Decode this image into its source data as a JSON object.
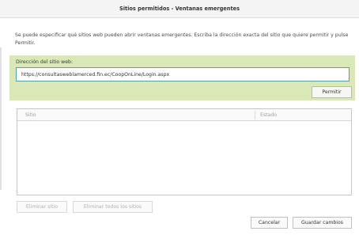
{
  "dialog": {
    "title": "Sitios permitidos - Ventanas emergentes",
    "description": "Se puede especificar qué sitios web pueden abrir ventanas emergentes. Escriba la dirección exacta del sitio que quiere permitir y pulse Permitir."
  },
  "address": {
    "label": "Dirección del sitio web:",
    "value": "https://consultasweblamerced.fin.ec/CoopOnLine/Login.aspx",
    "allow_label": "Permitir"
  },
  "table": {
    "columns": [
      "Sitio",
      "Estado"
    ],
    "rows": []
  },
  "buttons": {
    "remove_site": "Eliminar sitio",
    "remove_all": "Eliminar todos los sitios",
    "cancel": "Cancelar",
    "save": "Guardar cambios"
  },
  "colors": {
    "address_panel_bg": "#d9e8b6",
    "input_focus_border": "#4fa3a8"
  }
}
